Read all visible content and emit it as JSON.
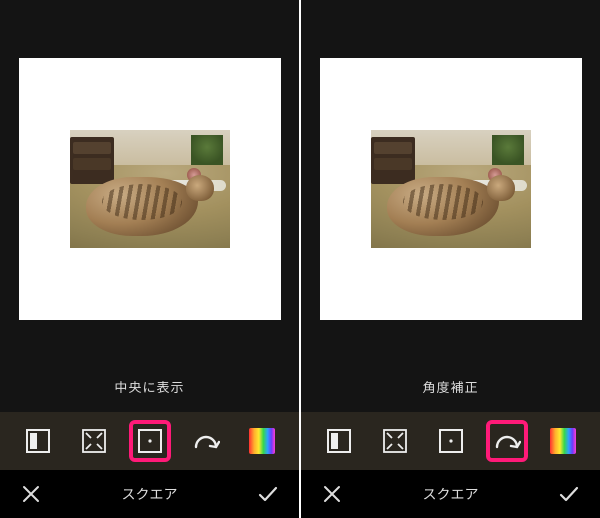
{
  "left": {
    "hint": "中央に表示",
    "mode_label": "スクエア",
    "selected_tool": "center"
  },
  "right": {
    "hint": "角度補正",
    "mode_label": "スクエア",
    "selected_tool": "rotate"
  },
  "tools": {
    "margin": "margin-icon",
    "fit": "fit-icon",
    "center": "center-icon",
    "rotate": "rotate-icon",
    "color": "color-icon"
  },
  "actions": {
    "cancel": "✕",
    "confirm": "✓"
  }
}
